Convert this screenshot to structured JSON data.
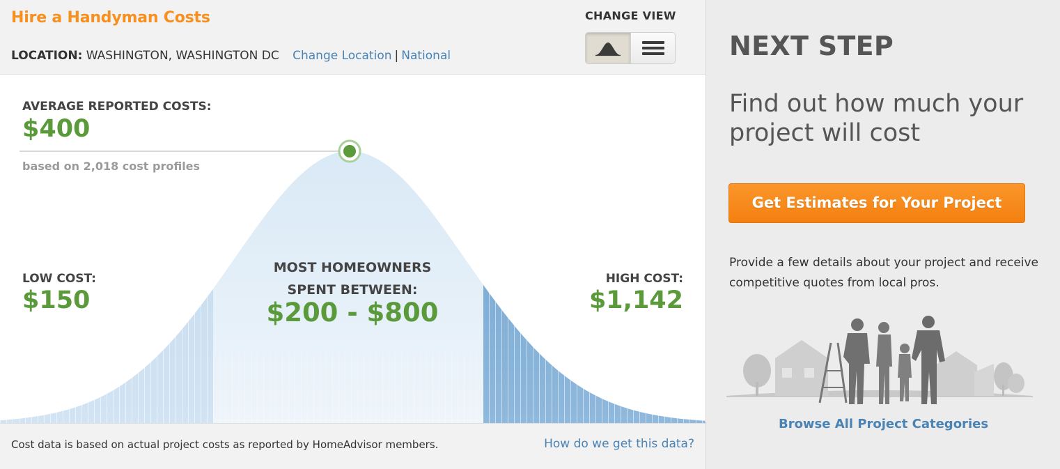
{
  "header": {
    "title": "Hire a Handyman Costs",
    "location_label": "LOCATION:",
    "location_value": "WASHINGTON, WASHINGTON DC",
    "change_location_link": "Change Location",
    "separator": "|",
    "national_link": "National",
    "change_view_label": "CHANGE VIEW"
  },
  "view_toggle": {
    "options": [
      {
        "icon": "bell-curve-icon",
        "active": true
      },
      {
        "icon": "list-icon",
        "active": false
      }
    ]
  },
  "chart": {
    "average": {
      "label": "AVERAGE REPORTED COSTS:",
      "value": "$400",
      "subtext": "based on 2,018 cost profiles"
    },
    "low": {
      "label": "LOW COST:",
      "value": "$150"
    },
    "high": {
      "label": "HIGH COST:",
      "value": "$1,142"
    },
    "most": {
      "label_line1": "MOST HOMEOWNERS",
      "label_line2": "SPENT BETWEEN:",
      "value": "$200 - $800"
    }
  },
  "footer": {
    "note": "Cost data is based on actual project costs as reported by HomeAdvisor members.",
    "link": "How do we get this data?"
  },
  "sidebar": {
    "heading": "NEXT STEP",
    "headline": "Find out how much your project will cost",
    "cta_button": "Get Estimates for Your Project",
    "description": "Provide a few details about your project and receive competitive quotes from local pros.",
    "browse_link": "Browse All Project Categories"
  },
  "colors": {
    "title_orange": "#f7901e",
    "value_green": "#5a9a3a",
    "link_blue": "#4a83b4",
    "cta_orange": "#f7891c"
  }
}
